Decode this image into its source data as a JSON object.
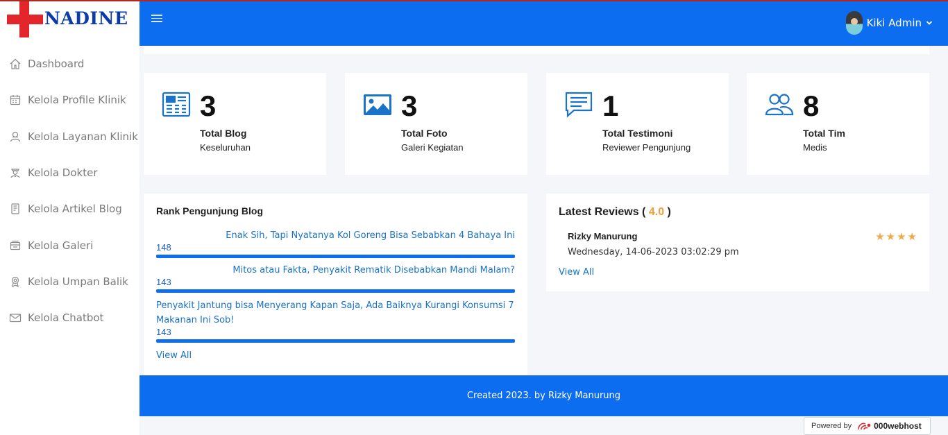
{
  "brand": {
    "name": "NADINE",
    "cross_color": "#e3262b",
    "text_color": "#0d3ca8"
  },
  "header": {
    "menu_icon": "hamburger-icon",
    "user_name": "Kiki Admin",
    "accent": "#0d6df0"
  },
  "sidebar": {
    "items": [
      {
        "label": "Dashboard",
        "icon": "home-icon"
      },
      {
        "label": "Kelola Profile Klinik",
        "icon": "calendar-icon"
      },
      {
        "label": "Kelola Layanan Klinik",
        "icon": "user-cog-icon"
      },
      {
        "label": "Kelola Dokter",
        "icon": "doctor-icon"
      },
      {
        "label": "Kelola Artikel Blog",
        "icon": "article-icon"
      },
      {
        "label": "Kelola Galeri",
        "icon": "gallery-icon"
      },
      {
        "label": "Kelola Umpan Balik",
        "icon": "feedback-icon"
      },
      {
        "label": "Kelola Chatbot",
        "icon": "mail-icon"
      }
    ]
  },
  "stats": [
    {
      "value": "3",
      "title": "Total Blog",
      "subtitle": "Keseluruhan",
      "icon": "newspaper-icon"
    },
    {
      "value": "3",
      "title": "Total Foto",
      "subtitle": "Galeri Kegiatan",
      "icon": "image-icon"
    },
    {
      "value": "1",
      "title": "Total Testimoni",
      "subtitle": "Reviewer Pengunjung",
      "icon": "comment-icon"
    },
    {
      "value": "8",
      "title": "Total Tim",
      "subtitle": "Medis",
      "icon": "users-icon"
    }
  ],
  "rank": {
    "title": "Rank Pengunjung Blog",
    "items": [
      {
        "title": "Enak Sih, Tapi Nyatanya Kol Goreng Bisa Sebabkan 4 Bahaya Ini",
        "count": "148"
      },
      {
        "title": "Mitos atau Fakta, Penyakit Rematik Disebabkan Mandi Malam?",
        "count": "143"
      },
      {
        "title": "Penyakit Jantung bisa Menyerang Kapan Saja, Ada Baiknya Kurangi Konsumsi 7 Makanan Ini Sob!",
        "count": "143"
      }
    ],
    "view_all": "View All"
  },
  "reviews": {
    "title": "Latest Reviews (",
    "score": "4.0",
    "title_end": ")",
    "items": [
      {
        "name": "Rizky Manurung",
        "date": "Wednesday, 14-06-2023 03:02:29 pm",
        "rating": 4
      }
    ],
    "view_all": "View All"
  },
  "footer": {
    "text": "Created 2023. by Rizky Manurung"
  },
  "powered": {
    "label": "Powered by",
    "brand": "000webhost"
  }
}
